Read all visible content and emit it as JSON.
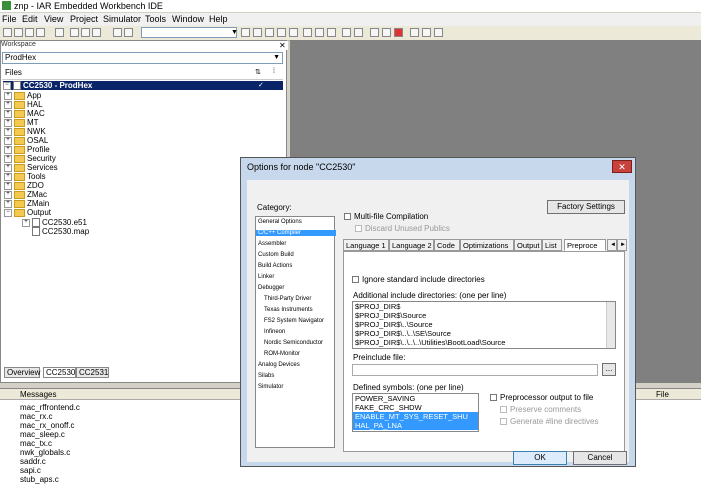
{
  "window": {
    "title": "znp - IAR Embedded Workbench IDE"
  },
  "menu": [
    "File",
    "Edit",
    "View",
    "Project",
    "Simulator",
    "Tools",
    "Window",
    "Help"
  ],
  "workspace": {
    "header": "Workspace",
    "combo": "ProdHex",
    "files_label": "Files",
    "root": "CC2530 - ProdHex",
    "items": [
      "App",
      "HAL",
      "MAC",
      "MT",
      "NWK",
      "OSAL",
      "Profile",
      "Security",
      "Services",
      "Tools",
      "ZDO",
      "ZMac",
      "ZMain",
      "Output"
    ],
    "output_files": [
      "CC2530.e51",
      "CC2530.map"
    ],
    "tabs": [
      "Overview",
      "CC2530",
      "CC2531"
    ]
  },
  "messages": {
    "header": "Messages",
    "file_header": "File",
    "lines": [
      "mac_rffrontend.c",
      "mac_rx.c",
      "mac_rx_onoff.c",
      "mac_sleep.c",
      "mac_tx.c",
      "nwk_globals.c",
      "saddr.c",
      "sapi.c",
      "stub_aps.c"
    ]
  },
  "dialog": {
    "title": "Options for node \"CC2530\"",
    "close": "✕",
    "category_label": "Category:",
    "categories": [
      "General Options",
      "C/C++ Compiler",
      "Assembler",
      "Custom Build",
      "Build Actions",
      "Linker",
      "Debugger"
    ],
    "debugger_subs": [
      "Third-Party Driver",
      "Texas Instruments",
      "FS2 System Navigator",
      "Infineon",
      "Nordic Semiconductor",
      "ROM-Monitor",
      "Analog Devices",
      "Silabs",
      "Simulator"
    ],
    "factory_settings": "Factory Settings",
    "multi_file": "Multi-file Compilation",
    "discard_unused": "Discard Unused Publics",
    "tabs": [
      "Language 1",
      "Language 2",
      "Code",
      "Optimizations",
      "Output",
      "List",
      "Preproce"
    ],
    "ignore_std": "Ignore standard include directories",
    "include_label": "Additional include directories: (one per line)",
    "include_dirs": [
      "$PROJ_DIR$",
      "$PROJ_DIR$\\Source",
      "$PROJ_DIR$\\..\\Source",
      "$PROJ_DIR$\\..\\..\\SE\\Source",
      "$PROJ_DIR$\\..\\..\\..\\Utilities\\BootLoad\\Source"
    ],
    "preinclude_label": "Preinclude file:",
    "browse": "...",
    "defined_label": "Defined symbols: (one per line)",
    "defined": [
      "POWER_SAVING",
      "FAKE_CRC_SHDW",
      "ENABLE_MT_SYS_RESET_SHU",
      "HAL_PA_LNA"
    ],
    "preproc_output": "Preprocessor output to file",
    "preserve_comments": "Preserve comments",
    "gen_line": "Generate #line directives",
    "ok": "OK",
    "cancel": "Cancel"
  }
}
